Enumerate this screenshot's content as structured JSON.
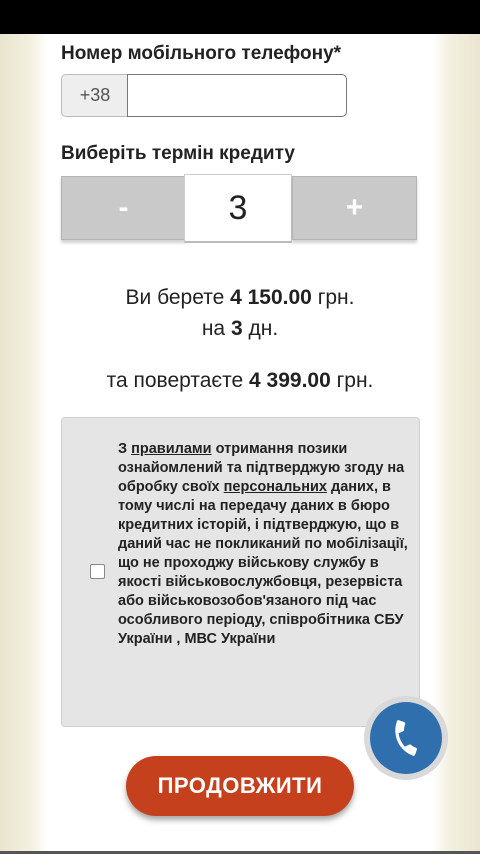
{
  "phone": {
    "label": "Номер мобільного телефону*",
    "prefix": "+38",
    "value": "",
    "placeholder": ""
  },
  "term": {
    "label": "Виберіть термін кредиту",
    "minus_label": "-",
    "value": "3",
    "plus_label": "+"
  },
  "summary": {
    "take_prefix": "Ви берете",
    "take_amount": "4 150.00",
    "take_currency": "грн.",
    "for_prefix": "на",
    "days": "3",
    "days_unit": "дн.",
    "return_prefix": "та повертаєте",
    "return_amount": "4 399.00",
    "return_currency": "грн."
  },
  "consent": {
    "checked": false,
    "text_1": "З",
    "rules_link": "правилами",
    "text_2": "отримання позики ознайомлений та підтверджую згоду на обробку своїх",
    "personal_link": "персональних",
    "text_3": "даних, в тому числі на передачу даних в бюро кредитних історій, і підтверджую, що в даний час не покликаний по мобілізації, що не проходжу військову службу в якості військовослужбовця, резервіста або військовозобов'язаного під час особливого періоду, співробітника СБУ України , МВС України"
  },
  "call_button": {
    "icon": "phone-icon",
    "color": "#2f6fae"
  },
  "continue_button": {
    "label": "ПРОДОВЖИТИ",
    "color": "#c5401c"
  }
}
